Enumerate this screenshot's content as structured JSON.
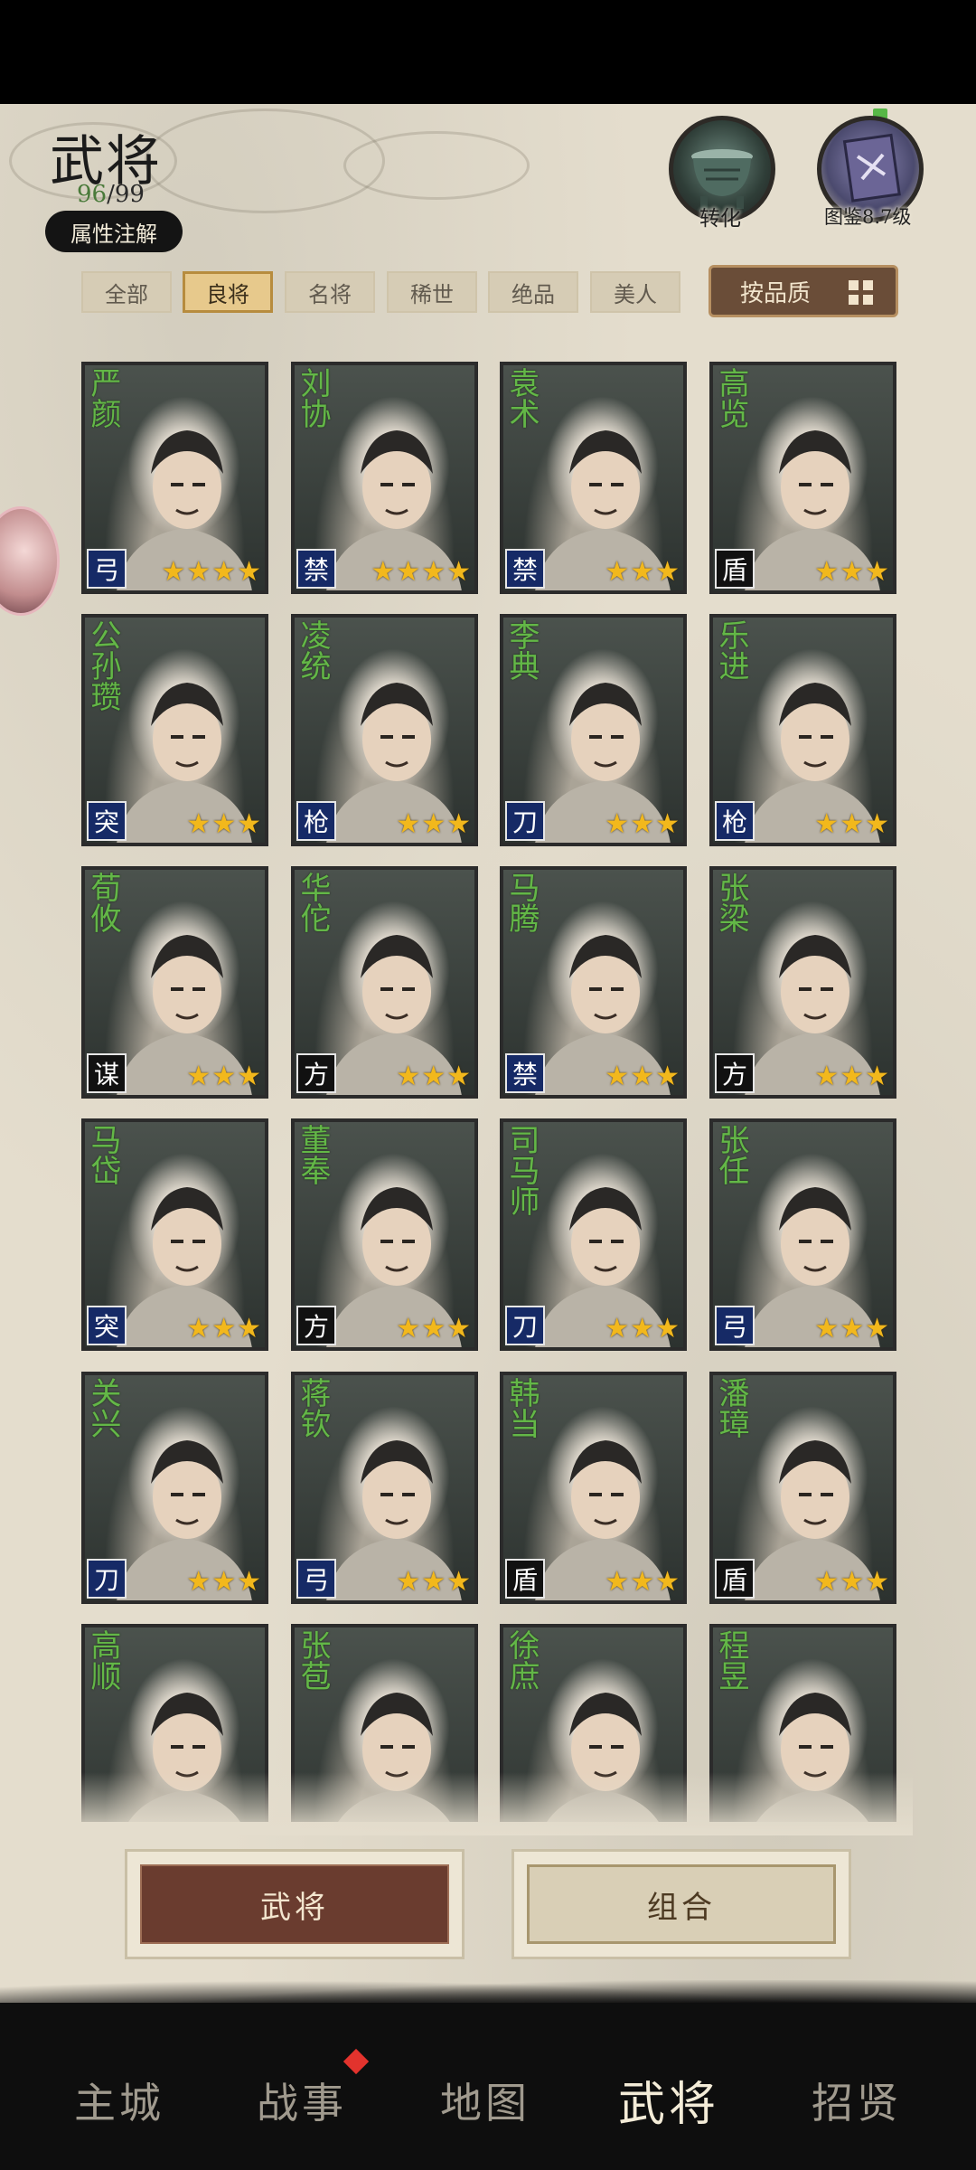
{
  "header": {
    "title": "武将",
    "count_current": "96",
    "count_total": "/99",
    "attr_button": "属性注解",
    "transform_label": "转化",
    "codex_label": "图鉴8.7级"
  },
  "tabs": [
    {
      "label": "全部",
      "active": false
    },
    {
      "label": "良将",
      "active": true
    },
    {
      "label": "名将",
      "active": false
    },
    {
      "label": "稀世",
      "active": false
    },
    {
      "label": "绝品",
      "active": false
    },
    {
      "label": "美人",
      "active": false
    }
  ],
  "sort_button": "按品质",
  "heroes": [
    {
      "name": "严颜",
      "unit": "弓",
      "stars": 4,
      "unit_style": "blue"
    },
    {
      "name": "刘协",
      "unit": "禁",
      "stars": 4,
      "unit_style": "blue"
    },
    {
      "name": "袁术",
      "unit": "禁",
      "stars": 3,
      "unit_style": "blue"
    },
    {
      "name": "高览",
      "unit": "盾",
      "stars": 3,
      "unit_style": "black"
    },
    {
      "name": "公孙瓒",
      "unit": "突",
      "stars": 3,
      "unit_style": "blue"
    },
    {
      "name": "凌统",
      "unit": "枪",
      "stars": 3,
      "unit_style": "blue"
    },
    {
      "name": "李典",
      "unit": "刀",
      "stars": 3,
      "unit_style": "blue"
    },
    {
      "name": "乐进",
      "unit": "枪",
      "stars": 3,
      "unit_style": "blue"
    },
    {
      "name": "荀攸",
      "unit": "谋",
      "stars": 3,
      "unit_style": "black"
    },
    {
      "name": "华佗",
      "unit": "方",
      "stars": 3,
      "unit_style": "black"
    },
    {
      "name": "马腾",
      "unit": "禁",
      "stars": 3,
      "unit_style": "blue"
    },
    {
      "name": "张梁",
      "unit": "方",
      "stars": 3,
      "unit_style": "black"
    },
    {
      "name": "马岱",
      "unit": "突",
      "stars": 3,
      "unit_style": "blue"
    },
    {
      "name": "董奉",
      "unit": "方",
      "stars": 3,
      "unit_style": "black"
    },
    {
      "name": "司马师",
      "unit": "刀",
      "stars": 3,
      "unit_style": "blue"
    },
    {
      "name": "张任",
      "unit": "弓",
      "stars": 3,
      "unit_style": "blue"
    },
    {
      "name": "关兴",
      "unit": "刀",
      "stars": 3,
      "unit_style": "blue"
    },
    {
      "name": "蒋钦",
      "unit": "弓",
      "stars": 3,
      "unit_style": "blue"
    },
    {
      "name": "韩当",
      "unit": "盾",
      "stars": 3,
      "unit_style": "black"
    },
    {
      "name": "潘璋",
      "unit": "盾",
      "stars": 3,
      "unit_style": "black"
    },
    {
      "name": "高顺",
      "unit": "",
      "stars": 0,
      "unit_style": "blue"
    },
    {
      "name": "张苞",
      "unit": "",
      "stars": 0,
      "unit_style": "blue"
    },
    {
      "name": "徐庶",
      "unit": "",
      "stars": 0,
      "unit_style": "blue"
    },
    {
      "name": "程昱",
      "unit": "",
      "stars": 0,
      "unit_style": "blue"
    }
  ],
  "bottom_buttons": {
    "heroes": "武将",
    "combo": "组合"
  },
  "nav": [
    {
      "label": "主城",
      "active": false
    },
    {
      "label": "战事",
      "active": false
    },
    {
      "label": "地图",
      "active": false
    },
    {
      "label": "武将",
      "active": true
    },
    {
      "label": "招贤",
      "active": false
    }
  ],
  "colors": {
    "name_green": "#63b747",
    "unit_blue": "#162a66",
    "star_gold": "#f2b81c",
    "active_tab": "#e7c98c",
    "primary_button": "#6a3c2f"
  }
}
